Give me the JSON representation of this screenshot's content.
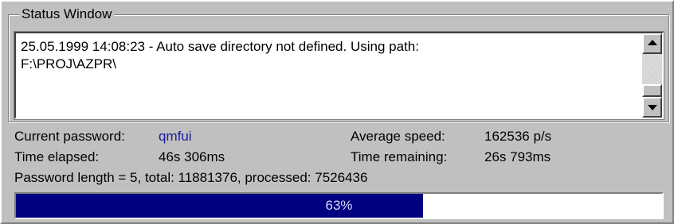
{
  "window": {
    "title": "Status Window"
  },
  "log": {
    "text": "25.05.1999 14:08:23 - Auto save directory not defined. Using path:\nF:\\PROJ\\AZPR\\"
  },
  "stats": {
    "current_password_label": "Current password:",
    "current_password_value": "qmfui",
    "average_speed_label": "Average speed:",
    "average_speed_value": "162536 p/s",
    "time_elapsed_label": "Time elapsed:",
    "time_elapsed_value": "46s 306ms",
    "time_remaining_label": "Time remaining:",
    "time_remaining_value": "26s 793ms",
    "summary": "Password length = 5, total: 11881376, processed: 7526436"
  },
  "progress": {
    "percent": 63,
    "label": "63%"
  },
  "colors": {
    "face": "#c0c0c0",
    "progress_fill": "#000080",
    "password_value": "#1a1aa0"
  },
  "icons": {
    "scroll_up": "up-arrow-icon",
    "scroll_down": "down-arrow-icon"
  }
}
